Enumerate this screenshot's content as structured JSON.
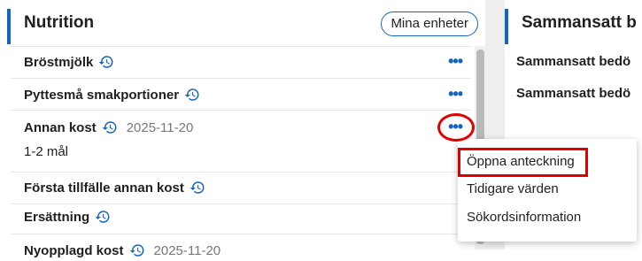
{
  "left_panel": {
    "title": "Nutrition",
    "pill": "Mina enheter",
    "rows": [
      {
        "label": "Bröstmjölk"
      },
      {
        "label": "Pyttesmå smakportioner"
      },
      {
        "label": "Annan kost",
        "date": "2025-11-20",
        "sub": "1-2 mål"
      },
      {
        "label": "Första tillfälle annan kost"
      },
      {
        "label": "Ersättning"
      },
      {
        "label": "Nyopplagd kost",
        "date": "2025-11-20"
      }
    ]
  },
  "right_panel": {
    "title": "Sammansatt b",
    "rows": [
      "Sammansatt bedö",
      "Sammansatt bedö"
    ]
  },
  "context_menu": {
    "items": [
      "Öppna anteckning",
      "Tidigare värden",
      "Sökordsinformation"
    ]
  },
  "colors": {
    "accent": "#1565c0",
    "highlight": "#e00000"
  },
  "icons": {
    "history": "history-icon",
    "more": "more-dots-icon"
  }
}
